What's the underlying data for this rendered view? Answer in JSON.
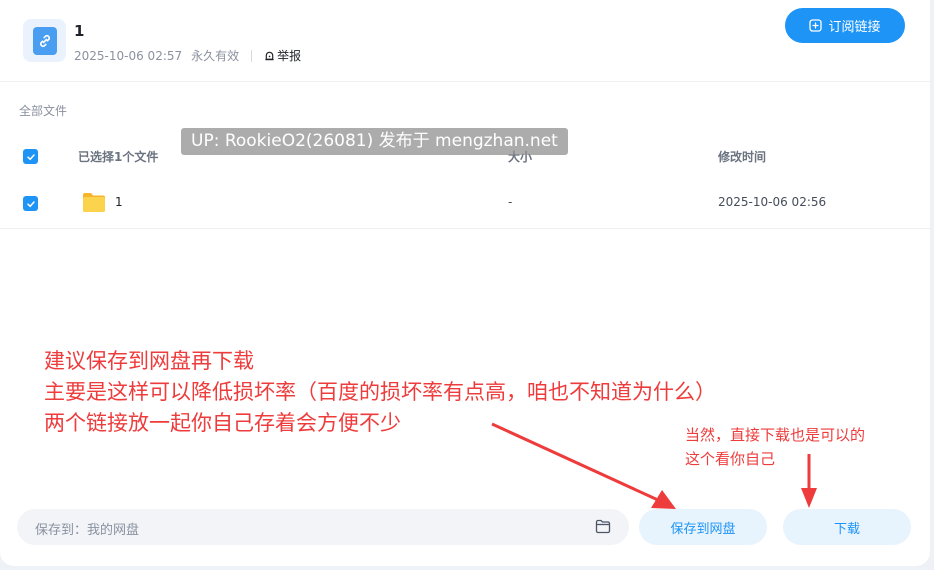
{
  "share": {
    "title": "1",
    "date": "2025-10-06 02:57",
    "validity": "永久有效",
    "report_label": "举报"
  },
  "header": {
    "subscribe_label": "订阅链接"
  },
  "files": {
    "section_label": "全部文件",
    "selected_label": "已选择1个文件",
    "col_size": "大小",
    "col_modified": "修改时间",
    "rows": [
      {
        "name": "1",
        "size": "-",
        "modified": "2025-10-06 02:56"
      }
    ]
  },
  "watermark": "UP: RookieO2(26081) 发布于 mengzhan.net",
  "annotations": {
    "line1": "建议保存到网盘再下载",
    "line2": "主要是这样可以降低损坏率（百度的损坏率有点高，咱也不知道为什么）",
    "line3": "两个链接放一起你自己存着会方便不少",
    "note1": "当然，直接下载也是可以的",
    "note2": "这个看你自己"
  },
  "footer": {
    "save_to_label": "保存到：我的网盘",
    "save_button": "保存到网盘",
    "download_button": "下载"
  },
  "colors": {
    "accent": "#1e94f6",
    "annotation": "#ee3b3b"
  }
}
